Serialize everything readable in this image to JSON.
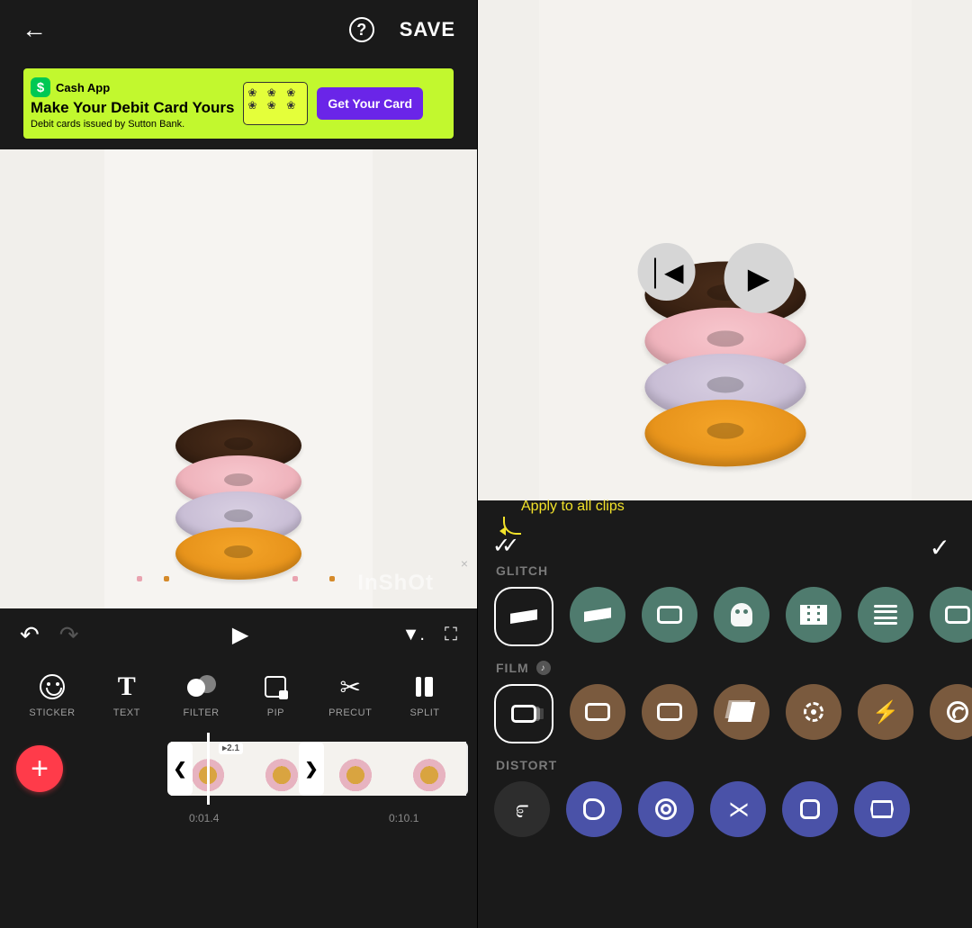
{
  "left": {
    "header": {
      "save_label": "SAVE",
      "help_glyph": "?"
    },
    "ad": {
      "brand": "Cash App",
      "title": "Make Your Debit Card Yours",
      "subtitle": "Debit cards issued by Sutton Bank.",
      "cta": "Get Your Card",
      "logo_letter": "$"
    },
    "watermark": "InShOt",
    "tools": [
      {
        "key": "sticker",
        "label": "STICKER"
      },
      {
        "key": "text",
        "label": "TEXT"
      },
      {
        "key": "filter",
        "label": "FILTER"
      },
      {
        "key": "pip",
        "label": "PIP"
      },
      {
        "key": "precut",
        "label": "PRECUT"
      },
      {
        "key": "split",
        "label": "SPLIT"
      }
    ],
    "timeline": {
      "speed_badge": "▸2.1",
      "time_start": "0:01.4",
      "time_end": "0:10.1"
    }
  },
  "right": {
    "tip": "Apply to all clips",
    "categories": [
      {
        "key": "glitch",
        "label": "GLITCH",
        "music": false,
        "effects": [
          "glitch-noise",
          "glitch-shift",
          "glitch-split",
          "glitch-ghost",
          "glitch-brick",
          "glitch-blur",
          "glitch-edge"
        ]
      },
      {
        "key": "film",
        "label": "FILM",
        "music": true,
        "effects": [
          "film-frame",
          "film-frame-2",
          "film-frame-3",
          "film-pages",
          "film-target",
          "film-flash",
          "film-lens"
        ]
      },
      {
        "key": "distort",
        "label": "DISTORT",
        "music": false,
        "effects": [
          "distort-swirl",
          "distort-blob",
          "distort-lines",
          "distort-hourglass",
          "distort-hex",
          "distort-pincushion"
        ]
      }
    ],
    "colors": {
      "glitch": "#4f7b6e",
      "film": "#7a5a3e",
      "distort": "#4a52a8"
    }
  }
}
